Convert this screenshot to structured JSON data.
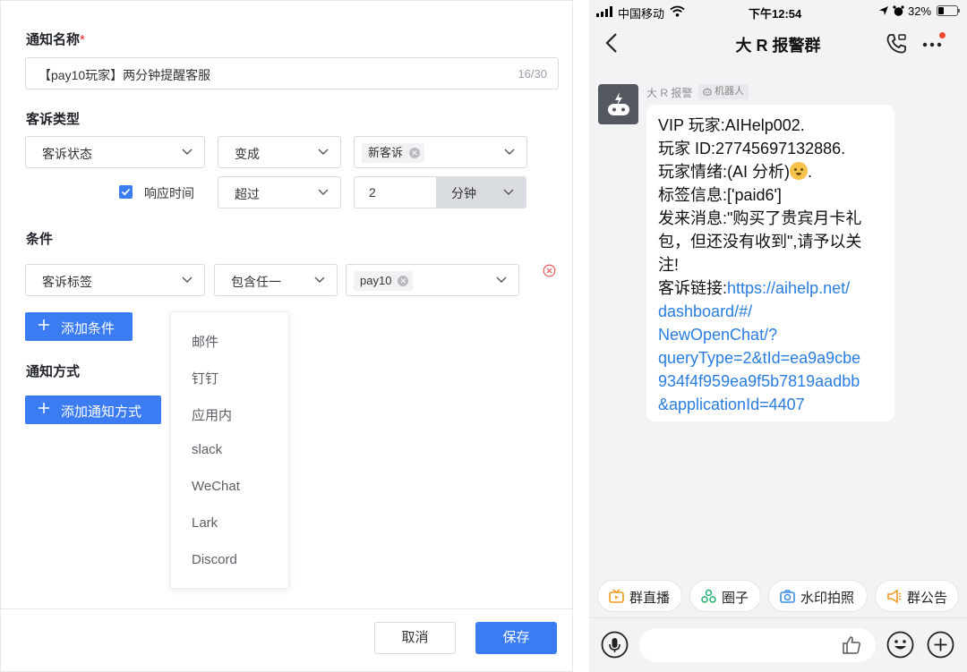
{
  "form": {
    "name_label": "通知名称",
    "required_mark": "*",
    "name_value": "【pay10玩家】两分钟提醒客服",
    "name_count": "16/30",
    "type_label": "客诉类型",
    "row1": {
      "field": "客诉状态",
      "op": "变成",
      "tag": "新客诉"
    },
    "row2": {
      "checkbox_label": "响应时间",
      "checked": true,
      "op": "超过",
      "value": "2",
      "unit": "分钟"
    },
    "condition_label": "条件",
    "cond_row": {
      "field": "客诉标签",
      "op": "包含任一",
      "tag": "pay10"
    },
    "add_condition": "添加条件",
    "notify_label": "通知方式",
    "add_notify": "添加通知方式",
    "notify_options": [
      "邮件",
      "钉钉",
      "应用内",
      "slack",
      "WeChat",
      "Lark",
      "Discord"
    ],
    "cancel": "取消",
    "save": "保存"
  },
  "phone": {
    "status": {
      "carrier": "中国移动",
      "time": "下午12:54",
      "battery": "32%",
      "battery_level": 0.32
    },
    "title": "大 R 报警群",
    "message": {
      "sender": "大 R 报警",
      "badge": "机器人",
      "lines": [
        "VIP 玩家:AIHelp002.",
        "玩家 ID:27745697132886.",
        "玩家情绪:(AI 分析)",
        "标签信息:['paid6']",
        "发来消息:\"购买了贵宾月卡礼",
        "包，但还没有收到\",请予以关",
        "注!"
      ],
      "emotion_suffix": ".",
      "link_prefix": "客诉链接:",
      "link_lines": [
        "https://aihelp.net/",
        "dashboard/#/",
        "NewOpenChat/?",
        "queryType=2&tId=ea9a9cbe",
        "934f4f959ea9f5b7819aadbb",
        "&applicationId=4407"
      ]
    },
    "quick_actions": [
      "群直播",
      "圈子",
      "水印拍照",
      "群公告"
    ],
    "colors": {
      "link": "#2a7de1",
      "accent": "#3b7cf3"
    }
  }
}
